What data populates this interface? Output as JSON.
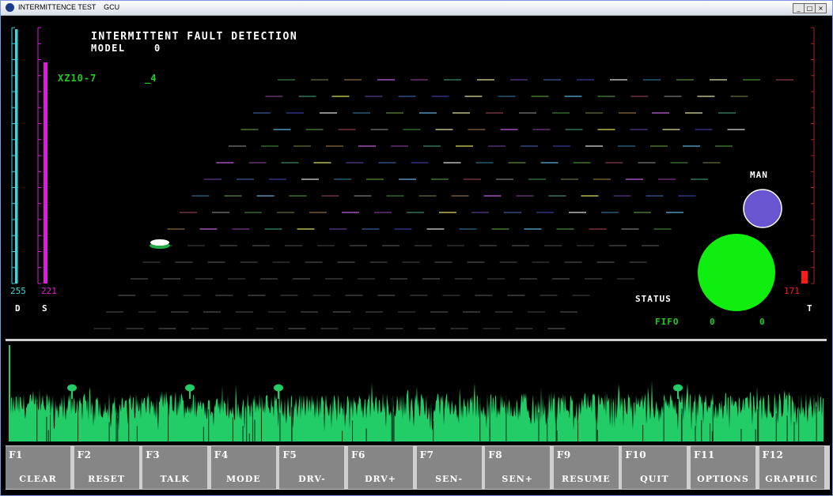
{
  "window": {
    "title": "INTERMITTENCE TEST    GCU"
  },
  "display": {
    "heading": "INTERMITTENT FAULT DETECTION",
    "model_label": "MODEL",
    "model_value": "0",
    "device_id": "XZ10-7",
    "device_suffix": "_4",
    "drive_value": "255",
    "drive_level": 1.0,
    "sense_value": "221",
    "sense_level": 0.87,
    "t_value": "171",
    "t_level": 0.05,
    "d_label": "D",
    "s_label": "S",
    "t_label": "T",
    "mode_indicator_label": "MAN",
    "status_label": "STATUS",
    "fifo_label": "FIFO",
    "fifo_value_1": "0",
    "fifo_value_2": "0",
    "colors": {
      "drive_bar": "#3ad6de",
      "sense_bar": "#e01ae0",
      "t_bar": "#ff1a1a",
      "man_indicator": "#6a55d0",
      "status_indicator": "#10ee10",
      "waveform": "#22cc66",
      "label_green": "#22cc22"
    }
  },
  "function_keys": [
    {
      "key": "F1",
      "label": "CLEAR"
    },
    {
      "key": "F2",
      "label": "RESET"
    },
    {
      "key": "F3",
      "label": "TALK"
    },
    {
      "key": "F4",
      "label": "MODE"
    },
    {
      "key": "F5",
      "label": "DRV-"
    },
    {
      "key": "F6",
      "label": "DRV+"
    },
    {
      "key": "F7",
      "label": "SEN-"
    },
    {
      "key": "F8",
      "label": "SEN+"
    },
    {
      "key": "F9",
      "label": "RESUME"
    },
    {
      "key": "F10",
      "label": "QUIT"
    },
    {
      "key": "F11",
      "label": "OPTIONS"
    },
    {
      "key": "F12",
      "label": "GRAPHIC"
    }
  ]
}
